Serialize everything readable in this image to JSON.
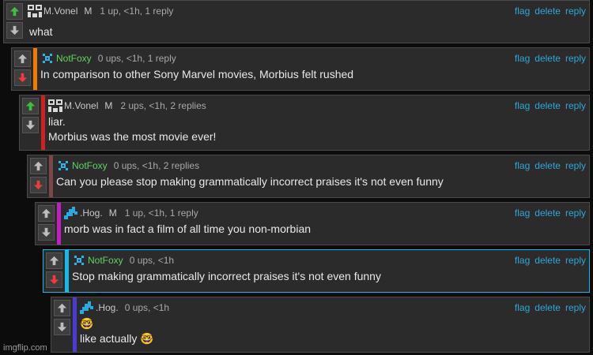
{
  "theme": {
    "up_active": "#3fbf3f",
    "down_active": "#ee3b3b",
    "arrow_idle": "#bdbdbd",
    "link": "#2fa7d6",
    "bar_colors": [
      "#f07b00",
      "#cc2222",
      "#7a4848",
      "#c020c0",
      "#18b8e8",
      "#4d3ad6"
    ]
  },
  "actions": {
    "flag": "flag",
    "delete": "delete",
    "reply": "reply"
  },
  "comments": [
    {
      "user": "M.Vonel",
      "avatar_icon": "mvonel-pixel-avatar-icon",
      "badge": "M",
      "info": "1 up, <1h, 1 reply",
      "lines": [
        "what"
      ],
      "vote": "up"
    },
    {
      "user": "NotFoxy",
      "avatar_icon": "notfoxy-pixel-avatar-icon",
      "badge": "",
      "info": "0 ups, <1h, 1 reply",
      "lines": [
        "In comparison to other Sony Marvel movies, Morbius felt rushed"
      ],
      "vote": "down"
    },
    {
      "user": "M.Vonel",
      "avatar_icon": "mvonel-pixel-avatar-icon",
      "badge": "M",
      "info": "2 ups, <1h, 2 replies",
      "lines": [
        "liar.",
        "Morbius was the most movie ever!"
      ],
      "vote": "up"
    },
    {
      "user": "NotFoxy",
      "avatar_icon": "notfoxy-pixel-avatar-icon",
      "badge": "",
      "info": "0 ups, <1h, 2 replies",
      "lines": [
        "Can you please stop making grammatically incorrect praises it's not even funny"
      ],
      "vote": "down"
    },
    {
      "user": ".Hog.",
      "avatar_icon": "hog-pixel-avatar-icon",
      "badge": "M",
      "info": "1 up, <1h, 1 reply",
      "lines": [
        "morb was in fact a film of all time you non-morbian"
      ],
      "vote": "none"
    },
    {
      "user": "NotFoxy",
      "avatar_icon": "notfoxy-pixel-avatar-icon",
      "badge": "",
      "info": "0 ups, <1h",
      "lines": [
        "Stop making grammatically incorrect praises it's not even funny"
      ],
      "vote": "down"
    },
    {
      "user": ".Hog.",
      "avatar_icon": "hog-pixel-avatar-icon",
      "badge": "",
      "info": "0 ups, <1h",
      "lines": [
        "🤓",
        "like actually 🤓"
      ],
      "vote": "none"
    }
  ],
  "watermark": "imgflip.com"
}
